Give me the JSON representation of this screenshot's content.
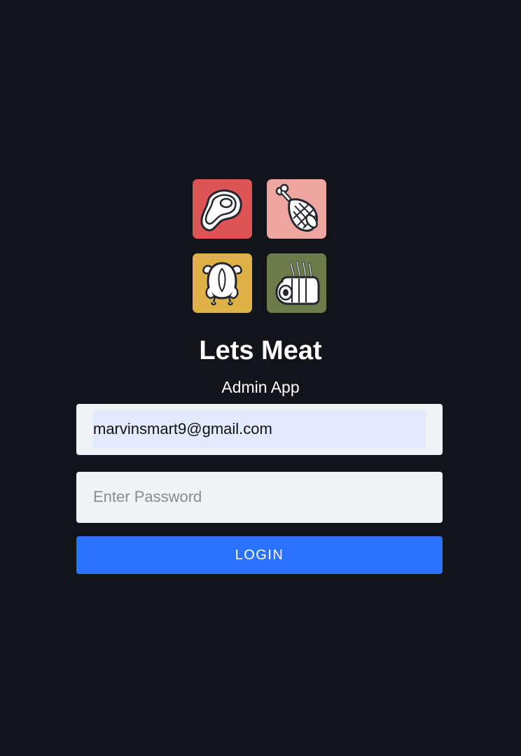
{
  "app": {
    "title": "Lets Meat",
    "subtitle": "Admin App"
  },
  "logo": {
    "tiles": [
      {
        "icon": "steak-icon",
        "color": "#de5356"
      },
      {
        "icon": "ham-leg-icon",
        "color": "#eca59f"
      },
      {
        "icon": "roast-chicken-icon",
        "color": "#deb147"
      },
      {
        "icon": "lamb-rack-icon",
        "color": "#6b7b4a"
      }
    ]
  },
  "form": {
    "email": {
      "value": "marvinsmart9@gmail.com",
      "placeholder": ""
    },
    "password": {
      "value": "",
      "placeholder": "Enter Password"
    },
    "login_label": "LOGIN"
  },
  "colors": {
    "background": "#131419",
    "field_background": "#f1f2f6",
    "autofill_highlight": "#e2ebfd",
    "primary_button": "#2a72ff"
  }
}
